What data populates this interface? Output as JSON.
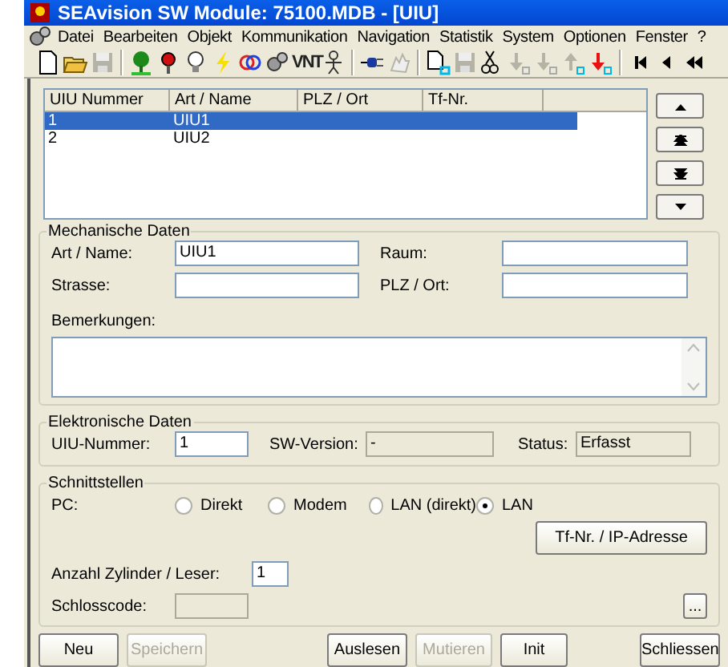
{
  "window": {
    "title": "SEAvision SW Module: 75100.MDB - [UIU]"
  },
  "menu": [
    "Datei",
    "Bearbeiten",
    "Objekt",
    "Kommunikation",
    "Navigation",
    "Statistik",
    "System",
    "Optionen",
    "Fenster",
    "?"
  ],
  "toolbar": [
    {
      "kind": "new",
      "disabled": false
    },
    {
      "kind": "open",
      "disabled": false
    },
    {
      "kind": "save",
      "disabled": true
    },
    {
      "kind": "separator"
    },
    {
      "kind": "tree",
      "disabled": false
    },
    {
      "kind": "pin",
      "disabled": false
    },
    {
      "kind": "bulb",
      "disabled": false
    },
    {
      "kind": "bolt",
      "disabled": false
    },
    {
      "kind": "rings",
      "disabled": false
    },
    {
      "kind": "gears",
      "disabled": false
    },
    {
      "kind": "text",
      "label": "VNT",
      "disabled": false
    },
    {
      "kind": "person",
      "disabled": false
    },
    {
      "kind": "separator"
    },
    {
      "kind": "plug",
      "disabled": false
    },
    {
      "kind": "hand",
      "disabled": true
    },
    {
      "kind": "separator"
    },
    {
      "kind": "new-badge",
      "disabled": false
    },
    {
      "kind": "save",
      "disabled": true
    },
    {
      "kind": "scissors",
      "disabled": false
    },
    {
      "kind": "down",
      "disabled": true
    },
    {
      "kind": "down",
      "disabled": true
    },
    {
      "kind": "up",
      "disabled": true
    },
    {
      "kind": "down",
      "disabled": false
    },
    {
      "kind": "separator"
    },
    {
      "kind": "first",
      "disabled": false
    },
    {
      "kind": "prev",
      "disabled": false
    },
    {
      "kind": "rewind",
      "disabled": false
    }
  ],
  "list": {
    "columns": [
      "UIU Nummer",
      "Art / Name",
      "PLZ / Ort",
      "Tf-Nr."
    ],
    "rows": [
      {
        "cells": [
          "1",
          "UIU1"
        ],
        "selected": true
      },
      {
        "cells": [
          "2",
          "UIU2"
        ],
        "selected": false
      }
    ]
  },
  "side_buttons": [
    {
      "kind": "up"
    },
    {
      "kind": "top"
    },
    {
      "kind": "bottom"
    },
    {
      "kind": "down"
    }
  ],
  "mechanical": {
    "title": "Mechanische Daten",
    "fields": [
      {
        "label": "Art / Name:",
        "value": "UIU1"
      },
      {
        "label": "Raum:"
      },
      {
        "label": "Strasse:"
      },
      {
        "label": "PLZ / Ort:"
      }
    ],
    "remarks_label": "Bemerkungen:"
  },
  "electronic": {
    "title": "Elektronische Daten",
    "fields": [
      {
        "label": "UIU-Nummer:",
        "value": "1",
        "disabled": false
      },
      {
        "label": "SW-Version:",
        "value": "-",
        "disabled": true
      },
      {
        "label": "Status:",
        "value": "Erfasst",
        "disabled": true
      }
    ]
  },
  "interfaces": {
    "title": "Schnittstellen",
    "pc_label": "PC:",
    "options": [
      {
        "label": "Direkt",
        "selected": false
      },
      {
        "label": "Modem",
        "selected": false
      },
      {
        "label": "LAN (direkt)",
        "selected": false
      },
      {
        "label": "LAN",
        "selected": true
      }
    ],
    "address_button": "Tf-Nr. / IP-Adresse",
    "cylinders": {
      "label": "Anzahl Zylinder / Leser:",
      "value": "1"
    },
    "lock_code": {
      "label": "Schlosscode:",
      "disabled": true
    },
    "browse_button": "..."
  },
  "footer": {
    "left": [
      {
        "label": "Neu",
        "disabled": false
      },
      {
        "label": "Speichern",
        "disabled": true
      }
    ],
    "middle": [
      {
        "label": "Auslesen",
        "disabled": false
      },
      {
        "label": "Mutieren",
        "disabled": true
      },
      {
        "label": "Init",
        "disabled": false
      }
    ],
    "right": [
      {
        "label": "Schliessen",
        "disabled": false
      }
    ]
  }
}
